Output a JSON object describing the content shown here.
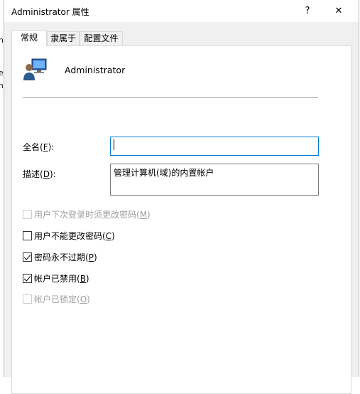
{
  "window": {
    "title": "Administrator 属性",
    "help_glyph": "?",
    "close_glyph": "✕"
  },
  "behind_letters": [
    "ni",
    "",
    "es",
    "h"
  ],
  "tabs": [
    {
      "label": "常规",
      "active": true
    },
    {
      "label": "隶属于",
      "active": false
    },
    {
      "label": "配置文件",
      "active": false
    }
  ],
  "general": {
    "user_icon": "user-computer-icon",
    "user_name": "Administrator",
    "fullname": {
      "label": "全名(",
      "key": "F",
      "suffix": "):",
      "value": ""
    },
    "description": {
      "label": "描述(",
      "key": "D",
      "suffix": "):",
      "value": "管理计算机(域)的内置帐户"
    },
    "checkboxes": [
      {
        "label": "用户下次登录时须更改密码(",
        "key": "M",
        "suffix": ")",
        "checked": false,
        "enabled": false
      },
      {
        "label": "用户不能更改密码(",
        "key": "C",
        "suffix": ")",
        "checked": false,
        "enabled": true
      },
      {
        "label": "密码永不过期(",
        "key": "P",
        "suffix": ")",
        "checked": true,
        "enabled": true
      },
      {
        "label": "帐户已禁用(",
        "key": "B",
        "suffix": ")",
        "checked": true,
        "enabled": true
      },
      {
        "label": "帐户已锁定(",
        "key": "O",
        "suffix": ")",
        "checked": false,
        "enabled": false
      }
    ]
  }
}
